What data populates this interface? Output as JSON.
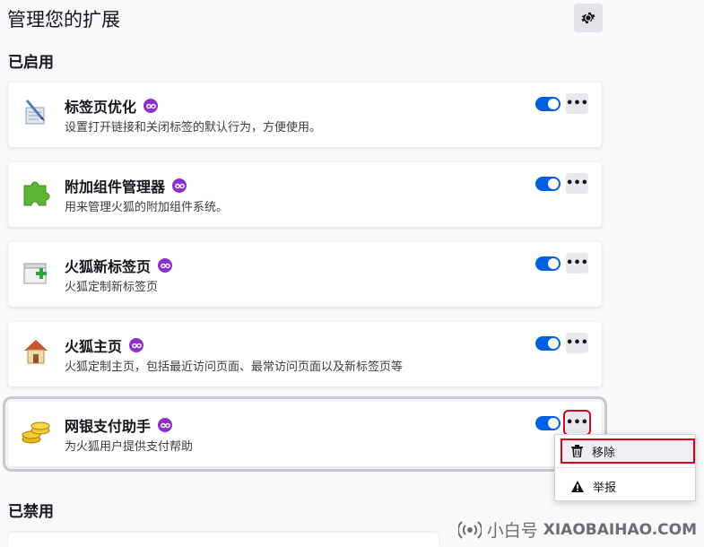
{
  "header": {
    "title": "管理您的扩展",
    "settings_icon": "gear-icon"
  },
  "sections": {
    "enabled_label": "已启用",
    "disabled_label": "已禁用"
  },
  "extensions": [
    {
      "name": "标签页优化",
      "description": "设置打开链接和关闭标签的默认行为，方便使用。",
      "icon": "pen-paper-icon",
      "enabled": true
    },
    {
      "name": "附加组件管理器",
      "description": "用来管理火狐的附加组件系统。",
      "icon": "puzzle-icon",
      "enabled": true
    },
    {
      "name": "火狐新标签页",
      "description": "火狐定制新标签页",
      "icon": "new-tab-icon",
      "enabled": true
    },
    {
      "name": "火狐主页",
      "description": "火狐定制主页，包括最近访问页面、最常访问页面以及新标签页等",
      "icon": "home-icon",
      "enabled": true
    },
    {
      "name": "网银支付助手",
      "description": "为火狐用户提供支付帮助",
      "icon": "coins-icon",
      "enabled": true
    }
  ],
  "more_label": "•••",
  "context_menu": {
    "remove_label": "移除",
    "report_label": "举报"
  },
  "watermark": {
    "brand": "小白号",
    "site": "XIAOBAIHAO.COM"
  },
  "colors": {
    "accent": "#0060df",
    "badge": "#8b2fc9",
    "highlight": "#d9001b"
  }
}
